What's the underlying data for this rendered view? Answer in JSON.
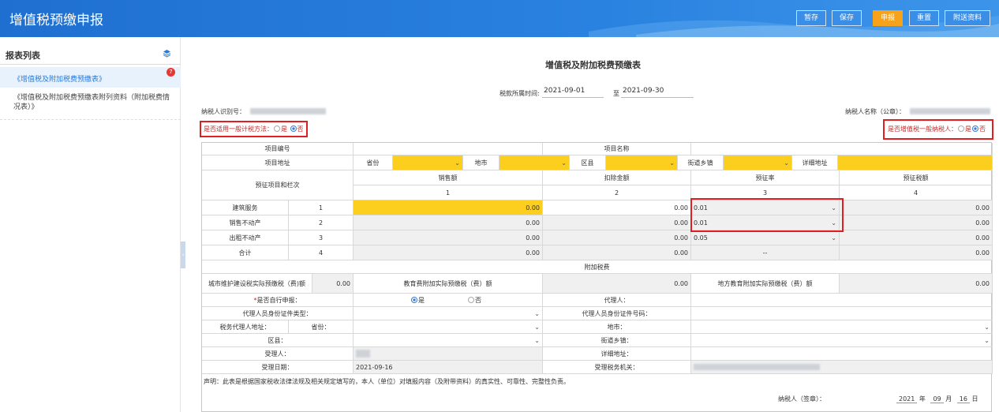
{
  "header": {
    "title": "增值税预缴申报",
    "buttons": {
      "save_temp": "暂存",
      "save": "保存",
      "submit": "申报",
      "reset": "重置",
      "attach": "附送资料"
    }
  },
  "sidebar": {
    "title": "报表列表",
    "badge": "7",
    "items": [
      {
        "label": "《增值税及附加税费预缴表》"
      },
      {
        "label": "《增值税及附加税费预缴表附列资料（附加税费情况表）》"
      }
    ]
  },
  "form": {
    "title": "增值税及附加税费预缴表",
    "period_label": "税款所属时间:",
    "period_start": "2021-09-01",
    "period_to": "至",
    "period_end": "2021-09-30",
    "taxpayer_id_label": "纳税人识别号：",
    "taxpayer_name_label": "纳税人名称（公章）：",
    "general_method_label": "是否适用一般计税方法：",
    "yes": "是",
    "no": "否",
    "general_taxpayer_label": "是否增值税一般纳税人："
  },
  "table": {
    "project_no_label": "项目编号",
    "project_name_label": "项目名称",
    "project_address_label": "项目地址",
    "province": "省份",
    "city": "地市",
    "county": "区县",
    "street": "街道乡镇",
    "detail_address": "详细地址",
    "items_label": "预征项目和栏次",
    "columns": [
      {
        "name": "销售额",
        "no": "1"
      },
      {
        "name": "扣除金额",
        "no": "2"
      },
      {
        "name": "预征率",
        "no": "3"
      },
      {
        "name": "预征税额",
        "no": "4"
      }
    ],
    "rows": [
      {
        "name": "建筑服务",
        "no": "1",
        "sales": "0.00",
        "deduct": "0.00",
        "rate": "0.01",
        "tax": "0.00"
      },
      {
        "name": "销售不动产",
        "no": "2",
        "sales": "0.00",
        "deduct": "0.00",
        "rate": "0.01",
        "tax": "0.00"
      },
      {
        "name": "出租不动产",
        "no": "3",
        "sales": "0.00",
        "deduct": "0.00",
        "rate": "0.05",
        "tax": "0.00"
      },
      {
        "name": "合计",
        "no": "4",
        "sales": "0.00",
        "deduct": "0.00",
        "rate": "--",
        "tax": "0.00"
      }
    ],
    "surcharge_label": "附加税费",
    "urban_tax_label": "城市维护建设税实际预缴税（费)额",
    "urban_tax_value": "0.00",
    "edu_label": "教育费附加实际预缴税（费）额",
    "edu_value": "0.00",
    "local_edu_label": "地方教育附加实际预缴税（费）额",
    "local_edu_value": "0.00",
    "self_declare_label": "是否自行申报：",
    "self_declare_star": "*",
    "agent_label": "代理人：",
    "agent_id_type_label": "代理人员身份证件类型：",
    "agent_id_no_label": "代理人员身份证件号码：",
    "agent_addr_label": "税务代理人地址：",
    "agent_province_label": "省份：",
    "agent_city_label": "地市：",
    "agent_county_label": "区县：",
    "agent_street_label": "街道乡镇：",
    "receiver_label": "受理人：",
    "detail_addr_label": "详细地址：",
    "accept_date_label": "受理日期：",
    "accept_date": "2021-09-16",
    "accept_office_label": "受理税务机关："
  },
  "footer": {
    "statement": "声明：此表是根据国家税收法律法规及相关规定填写的，本人（单位）对填报内容（及附带资料）的真实性、可靠性、完整性负责。",
    "sign_label": "纳税人（签章）：",
    "year": "2021",
    "year_unit": "年",
    "month": "09",
    "month_unit": "月",
    "day": "16",
    "day_unit": "日"
  }
}
